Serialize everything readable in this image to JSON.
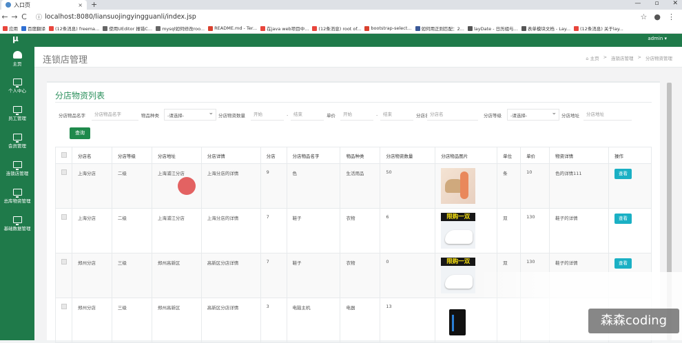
{
  "browser": {
    "tab_title": "入口页",
    "new_tab_glyph": "+",
    "tab_close_glyph": "×",
    "url_prefix": "ⓘ",
    "url": "localhost:8080/liansuojingyingguanli/index.jsp",
    "window_controls": [
      "—",
      "▫",
      "✕"
    ],
    "nav": [
      "←",
      "→",
      "C",
      "⌂"
    ],
    "right_icons": [
      "☆",
      "●",
      "⋮"
    ],
    "bookmarks": [
      {
        "label": "应用",
        "color": "#e8453c"
      },
      {
        "label": "百度翻译",
        "color": "#2f6fd3"
      },
      {
        "label": "(12条消息) freema...",
        "color": "#e8453c"
      },
      {
        "label": "使用UEditor 报错C...",
        "color": "#666666"
      },
      {
        "label": "mysql如何修改roo...",
        "color": "#666666"
      },
      {
        "label": "README.md - Ter...",
        "color": "#d9412f"
      },
      {
        "label": "在java web项目中...",
        "color": "#e8453c"
      },
      {
        "label": "(12条消息) root of...",
        "color": "#e8453c"
      },
      {
        "label": "bootstrap-select...",
        "color": "#d9412f"
      },
      {
        "label": "如何用正则匹配：2...",
        "color": "#3b5998"
      },
      {
        "label": "layDate - 日历组与...",
        "color": "#555555"
      },
      {
        "label": "表单模块文档 - Lay...",
        "color": "#555555"
      },
      {
        "label": "(12条消息) 关于lay...",
        "color": "#e8453c"
      }
    ]
  },
  "topbar": {
    "user": "admin ▾"
  },
  "sidebar": {
    "logo": "μ",
    "items": [
      {
        "label": "主页"
      },
      {
        "label": "个人中心"
      },
      {
        "label": "员工管理"
      },
      {
        "label": "会员管理"
      },
      {
        "label": "连锁店管理"
      },
      {
        "label": "总库物资管理"
      },
      {
        "label": "基础数据管理"
      }
    ]
  },
  "page": {
    "title": "连锁店管理",
    "breadcrumb": [
      "⌂ 主页",
      ">",
      "连锁店管理",
      ">",
      "分店物资管理"
    ]
  },
  "panel": {
    "title": "分店物资列表",
    "filters": {
      "goods_name_label": "分店物品名字",
      "goods_name_placeholder": "分店物品名字",
      "goods_type_label": "物品种类",
      "goods_type_value": "-请选择-",
      "qty_label": "分店物资数量",
      "qty_start": "开始",
      "qty_end": "结束",
      "price_label": "单价",
      "price_start": "开始",
      "price_end": "结束",
      "store_name_label": "分店名",
      "store_name_placeholder": "分店名",
      "store_level_label": "分店等级",
      "store_level_value": "-请选择-",
      "store_addr_label": "分店地址",
      "store_addr_placeholder": "分店地址",
      "dot": "."
    },
    "search_button": "查询",
    "columns": [
      "分店名",
      "分店等级",
      "分店地址",
      "分店详情",
      "分店",
      "分店物品名字",
      "物品种类",
      "分店物资数量",
      "分店物品图片",
      "单位",
      "单价",
      "物资详情",
      "操作"
    ],
    "rows": [
      {
        "store": "上海分店",
        "level": "二级",
        "addr": "上海浦江分店",
        "detail": "上海分店的详情",
        "no": "9",
        "goods": "色",
        "type": "生活用品",
        "qty": "50",
        "img": "p1",
        "unit": "条",
        "price": "10",
        "goods_detail": "色的详情111",
        "action": "查看"
      },
      {
        "store": "上海分店",
        "level": "二级",
        "addr": "上海浦江分店",
        "detail": "上海分店的详情",
        "no": "7",
        "goods": "鞋子",
        "type": "衣物",
        "qty": "6",
        "img": "shoe",
        "unit": "双",
        "price": "130",
        "goods_detail": "鞋子的详情",
        "action": "查看"
      },
      {
        "store": "郑州分店",
        "level": "三级",
        "addr": "郑州高新区",
        "detail": "高新区分店详情",
        "no": "7",
        "goods": "鞋子",
        "type": "衣物",
        "qty": "0",
        "img": "shoe",
        "unit": "双",
        "price": "130",
        "goods_detail": "鞋子的详情",
        "action": "查看"
      },
      {
        "store": "郑州分店",
        "level": "三级",
        "addr": "郑州高新区",
        "detail": "高新区分店详情",
        "no": "3",
        "goods": "电脑主机",
        "type": "电器",
        "qty": "13",
        "img": "pc",
        "unit": "",
        "price": "",
        "goods_detail": "",
        "action": ""
      }
    ],
    "shoe_banner": "限购一双"
  },
  "watermark": "森森coding"
}
